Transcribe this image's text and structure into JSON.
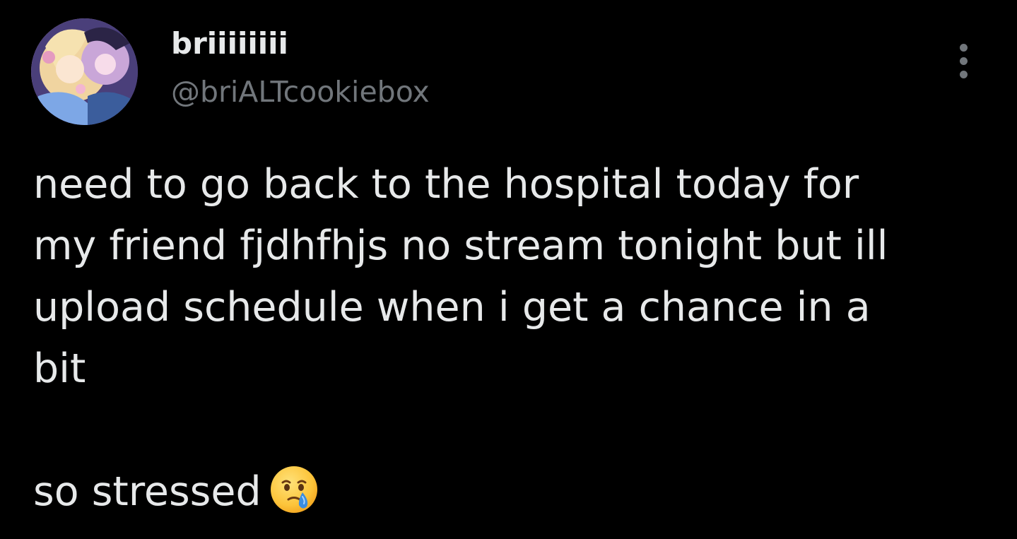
{
  "author": {
    "display_name": "briiiiiiii",
    "handle": "@briALTcookiebox",
    "avatar_icon": "avatar-image"
  },
  "actions": {
    "more_icon": "more-options-icon"
  },
  "tweet": {
    "text_lines": [
      "need to go back to the hospital today for",
      "my friend fjdhfhjs no stream tonight but ill",
      "upload schedule when i get a chance in a",
      "bit",
      "",
      "so stressed"
    ],
    "emoji": "face-holding-back-tears-emoji"
  },
  "colors": {
    "background": "#000000",
    "primary_text": "#e7e9ea",
    "secondary_text": "#71767b"
  }
}
